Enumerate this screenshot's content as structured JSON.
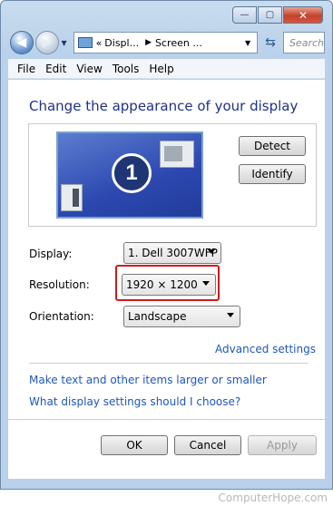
{
  "window": {
    "controls": {
      "minimize": "—",
      "maximize": "▢",
      "close": "✕"
    }
  },
  "nav": {
    "back_icon": "back-arrow-icon",
    "forward_icon": "forward-arrow-icon",
    "breadcrumb": {
      "chevrons": "«",
      "item1": "Displ...",
      "sep": "▶",
      "item2": "Screen ...",
      "drop": "▼"
    },
    "refresh_glyph": "⇆",
    "search_placeholder": "Search"
  },
  "menubar": [
    {
      "label": "File"
    },
    {
      "label": "Edit"
    },
    {
      "label": "View"
    },
    {
      "label": "Tools"
    },
    {
      "label": "Help"
    }
  ],
  "heading": "Change the appearance of your display",
  "monitor": {
    "number": "1"
  },
  "buttons": {
    "detect": "Detect",
    "identify": "Identify",
    "ok": "OK",
    "cancel": "Cancel",
    "apply": "Apply"
  },
  "settings": {
    "display_label": "Display:",
    "display_value": "1. Dell 3007WFP",
    "resolution_label": "Resolution:",
    "resolution_value": "1920 × 1200",
    "orientation_label": "Orientation:",
    "orientation_value": "Landscape"
  },
  "links": {
    "advanced": "Advanced settings",
    "text_size": "Make text and other items larger or smaller",
    "which_settings": "What display settings should I choose?"
  },
  "watermark": "ComputerHope.com",
  "colors": {
    "heading": "#1e3287",
    "link": "#1f57b8",
    "highlight": "#cc1d1d"
  }
}
